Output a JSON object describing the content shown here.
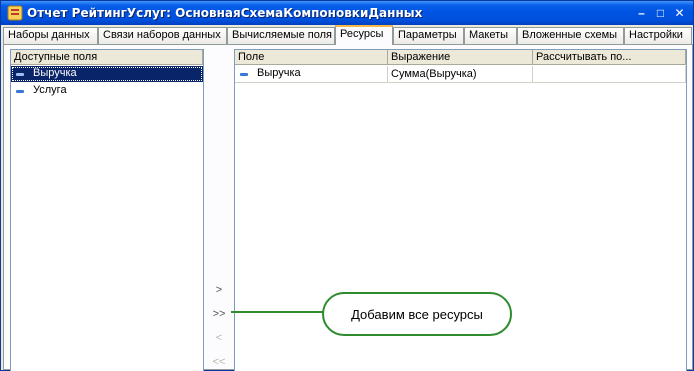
{
  "window": {
    "title": "Отчет РейтингУслуг: ОсновнаяСхемаКомпоновкиДанных",
    "minimize_glyph": "–",
    "maximize_glyph": "□",
    "close_glyph": "✕"
  },
  "tabs": [
    {
      "label": "Наборы данных"
    },
    {
      "label": "Связи наборов данных"
    },
    {
      "label": "Вычисляемые поля"
    },
    {
      "label": "Ресурсы",
      "active": true
    },
    {
      "label": "Параметры"
    },
    {
      "label": "Макеты"
    },
    {
      "label": "Вложенные схемы"
    },
    {
      "label": "Настройки"
    }
  ],
  "available_fields": {
    "header": "Доступные поля",
    "items": [
      {
        "label": "Выручка",
        "selected": true,
        "icon": "field-icon"
      },
      {
        "label": "Услуга",
        "selected": false,
        "icon": "field-icon"
      }
    ]
  },
  "move_buttons": {
    "add": ">",
    "add_all": ">>",
    "remove": "<",
    "remove_all": "<<"
  },
  "resources_table": {
    "columns": [
      "Поле",
      "Выражение",
      "Рассчитывать по..."
    ],
    "rows": [
      {
        "field": "Выручка",
        "expression": "Сумма(Выручка)",
        "calculate_by": ""
      }
    ]
  },
  "callout": {
    "text": "Добавим все ресурсы",
    "color": "#2e8b2e"
  }
}
